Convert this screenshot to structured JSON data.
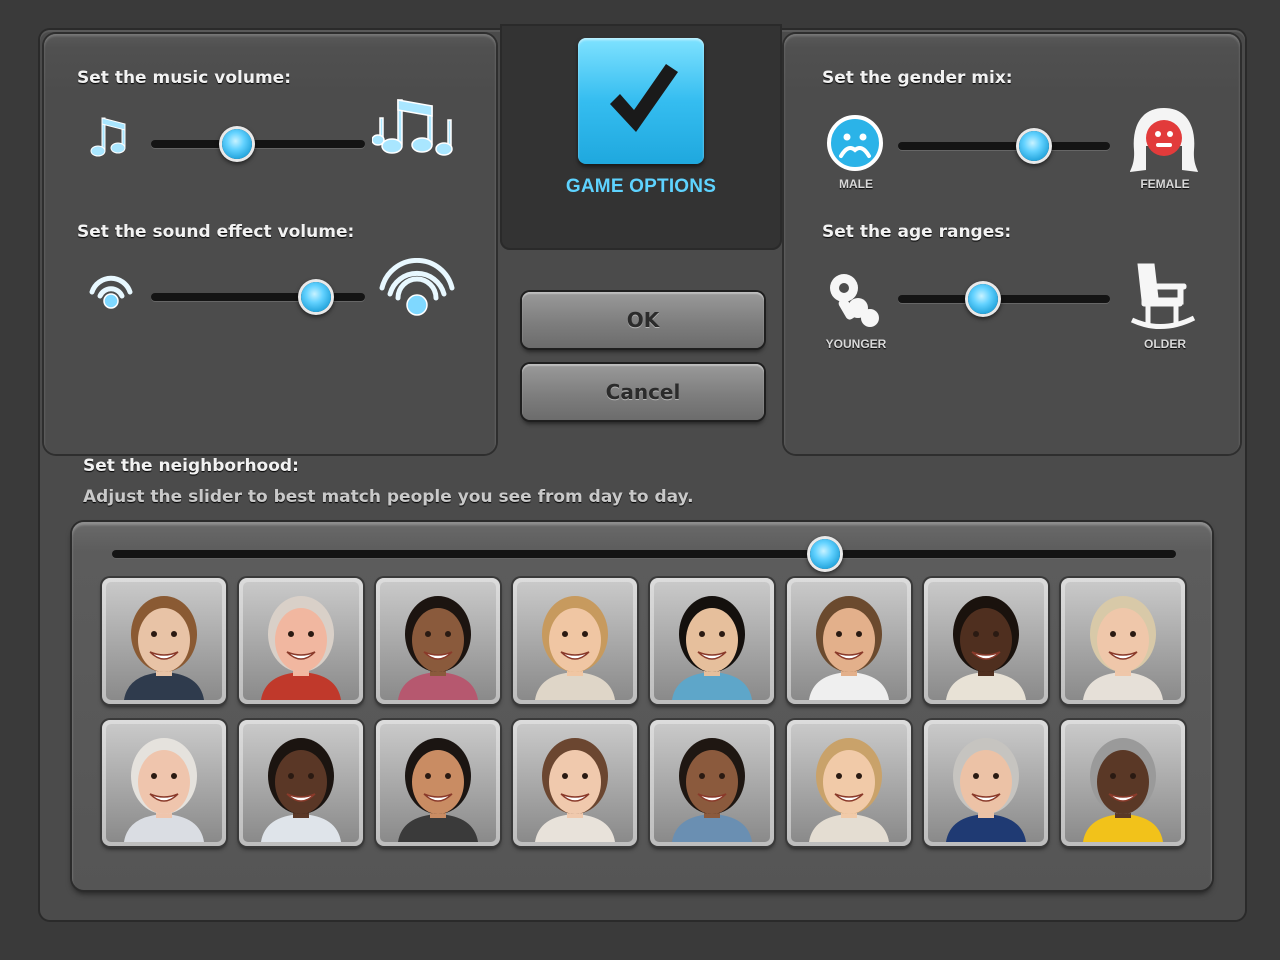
{
  "music": {
    "label": "Set the music volume:",
    "value": 0.4
  },
  "sound": {
    "label": "Set the sound effect volume:",
    "value": 0.77
  },
  "title": {
    "label": "GAME OPTIONS"
  },
  "gender": {
    "label": "Set the gender mix:",
    "value": 0.64,
    "min_caption": "MALE",
    "max_caption": "FEMALE"
  },
  "age": {
    "label": "Set the age ranges:",
    "value": 0.4,
    "min_caption": "YOUNGER",
    "max_caption": "OLDER"
  },
  "buttons": {
    "ok": "OK",
    "cancel": "Cancel"
  },
  "neighborhood": {
    "label": "Set the neighborhood:",
    "hint": "Adjust the slider to best match people you see from day to day.",
    "value": 0.67
  },
  "colors": {
    "accent": "#35bdf0",
    "panel": "#4c4c4c",
    "track": "#141414"
  },
  "faces": [
    {
      "skin": "#e8c3a6",
      "hair": "#8a5a33",
      "shirt": "#2f3b4d"
    },
    {
      "skin": "#f1b7a0",
      "hair": "#d9d0c8",
      "shirt": "#c0392b"
    },
    {
      "skin": "#8a5a3c",
      "hair": "#1c1410",
      "shirt": "#b6586f"
    },
    {
      "skin": "#f0c6a3",
      "hair": "#c79a5e",
      "shirt": "#dfd6c8"
    },
    {
      "skin": "#e6bf9c",
      "hair": "#14100d",
      "shirt": "#5ea6c9"
    },
    {
      "skin": "#e3b08b",
      "hair": "#6b4a2e",
      "shirt": "#efefef"
    },
    {
      "skin": "#4f2f1f",
      "hair": "#1a120d",
      "shirt": "#e8e2d6"
    },
    {
      "skin": "#efc7aa",
      "hair": "#d8c9a8",
      "shirt": "#e6e0d8"
    },
    {
      "skin": "#efc5ad",
      "hair": "#e5e2dd",
      "shirt": "#dadde3"
    },
    {
      "skin": "#5a3726",
      "hair": "#1b1410",
      "shirt": "#dfe4ea"
    },
    {
      "skin": "#c98c63",
      "hair": "#1b1512",
      "shirt": "#3a3a3a"
    },
    {
      "skin": "#f0c9ad",
      "hair": "#6b4630",
      "shirt": "#e8e2da"
    },
    {
      "skin": "#8b5a3d",
      "hair": "#1f1712",
      "shirt": "#6a8fb2"
    },
    {
      "skin": "#f1caa8",
      "hair": "#c9a26a",
      "shirt": "#e4ddd2"
    },
    {
      "skin": "#ecc2a6",
      "hair": "#c6c4c0",
      "shirt": "#1f3a73"
    },
    {
      "skin": "#5a3826",
      "hair": "#9a9a9a",
      "shirt": "#f2c21a"
    }
  ]
}
